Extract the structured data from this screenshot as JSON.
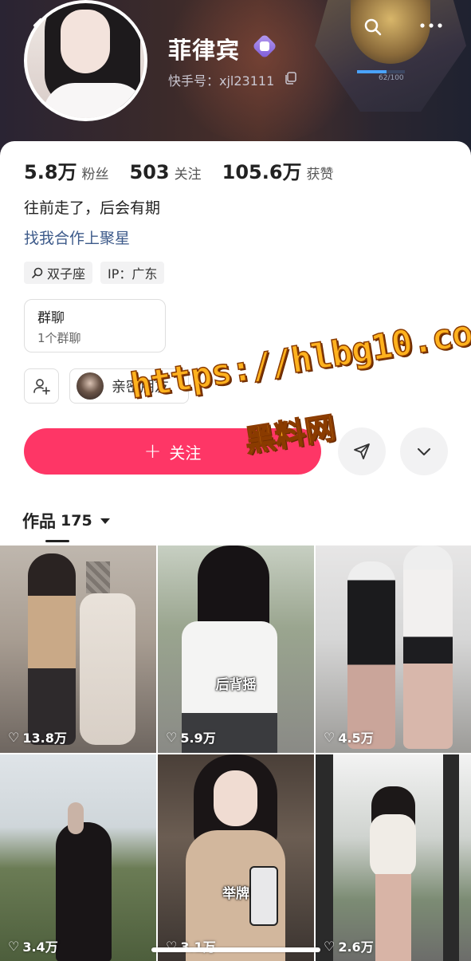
{
  "profile": {
    "name": "菲律宾",
    "kuaishou_id": "快手号：xjl23111",
    "level_text": "62/100",
    "level_fraction": 0.62
  },
  "stats": [
    {
      "num": "5.8万",
      "label": "粉丝"
    },
    {
      "num": "503",
      "label": "关注"
    },
    {
      "num": "105.6万",
      "label": "获赞"
    }
  ],
  "bio": "往前走了，后会有期",
  "collab_link": "找我合作上聚星",
  "tags": [
    {
      "icon": "search-icon",
      "text": "双子座"
    },
    {
      "icon": "",
      "text": "IP：广东"
    }
  ],
  "group": {
    "title": "群聊",
    "subtitle": "1个群聊"
  },
  "close_friends_label": "亲密朋友",
  "actions": {
    "follow_label": "关注"
  },
  "watermark": {
    "url": "https://hlbg10.com",
    "name": "黑料网"
  },
  "works": {
    "label": "作品",
    "count": "175"
  },
  "videos": [
    {
      "likes": "13.8万",
      "caption": ""
    },
    {
      "likes": "5.9万",
      "caption": "后背摇"
    },
    {
      "likes": "4.5万",
      "caption": ""
    },
    {
      "likes": "3.4万",
      "caption": ""
    },
    {
      "likes": "3.1万",
      "caption": "举牌"
    },
    {
      "likes": "2.6万",
      "caption": ""
    }
  ],
  "colors": {
    "follow": "#fe3666",
    "link": "#3d5a8a"
  }
}
